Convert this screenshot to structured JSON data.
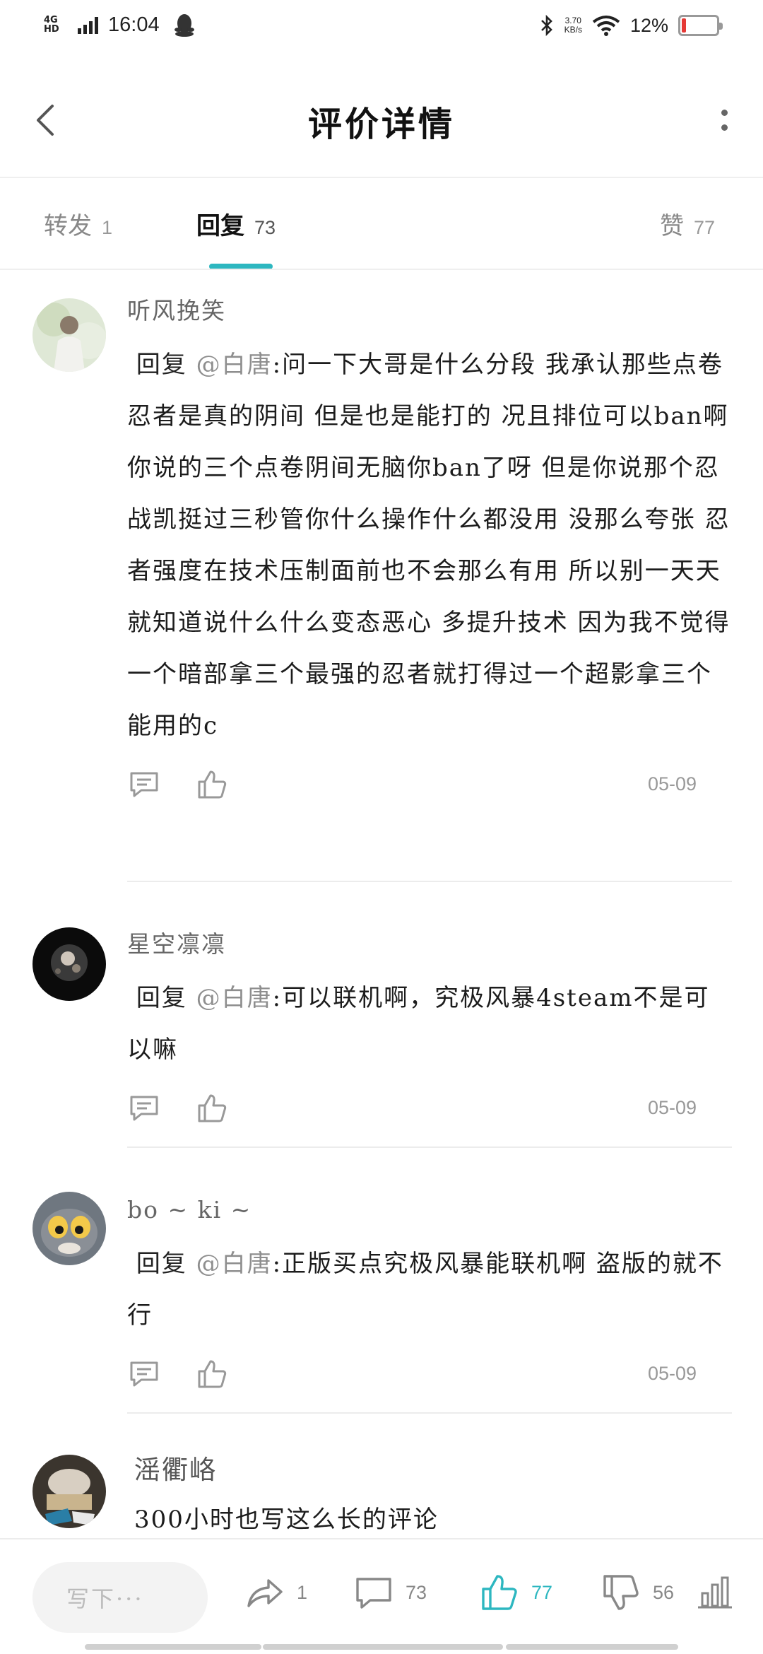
{
  "status_bar": {
    "network": "4G HD",
    "time": "16:04",
    "speed_value": "3.70",
    "speed_unit": "KB/s",
    "battery_percent": "12%",
    "battery_level": 0.12,
    "battery_color": "#e53935"
  },
  "header": {
    "title": "评价详情"
  },
  "tabs": [
    {
      "label": "转发",
      "count": "1",
      "active": false
    },
    {
      "label": "回复",
      "count": "73",
      "active": true
    },
    {
      "label": "赞",
      "count": "77",
      "active": false
    }
  ],
  "accent_color": "#2db7c0",
  "comments": [
    {
      "author": "听风挽笑",
      "reply_prefix": "回复",
      "mention": "@白唐",
      "text": ":问一下大哥是什么分段 我承认那些点卷忍者是真的阴间 但是也是能打的 况且排位可以ban啊 你说的三个点卷阴间无脑你ban了呀 但是你说那个忍战凯挺过三秒管你什么操作什么都没用 没那么夸张 忍者强度在技术压制面前也不会那么有用 所以别一天天就知道说什么什么变态恶心 多提升技术 因为我不觉得一个暗部拿三个最强的忍者就打得过一个超影拿三个能用的c",
      "date": "05-09"
    },
    {
      "author": "星空凛凛",
      "reply_prefix": "回复",
      "mention": "@白唐",
      "text": ":可以联机啊，究极风暴4steam不是可以嘛",
      "date": "05-09"
    },
    {
      "author": "bo ~ ki ~",
      "reply_prefix": "回复",
      "mention": "@白唐",
      "text": ":正版买点究极风暴能联机啊 盗版的就不行",
      "date": "05-09"
    },
    {
      "author": "滛衢峈",
      "text": "300小时也写这么长的评论"
    }
  ],
  "bottom_bar": {
    "write_placeholder": "写下···",
    "share_count": "1",
    "comment_count": "73",
    "like_count": "77",
    "dislike_count": "56"
  }
}
